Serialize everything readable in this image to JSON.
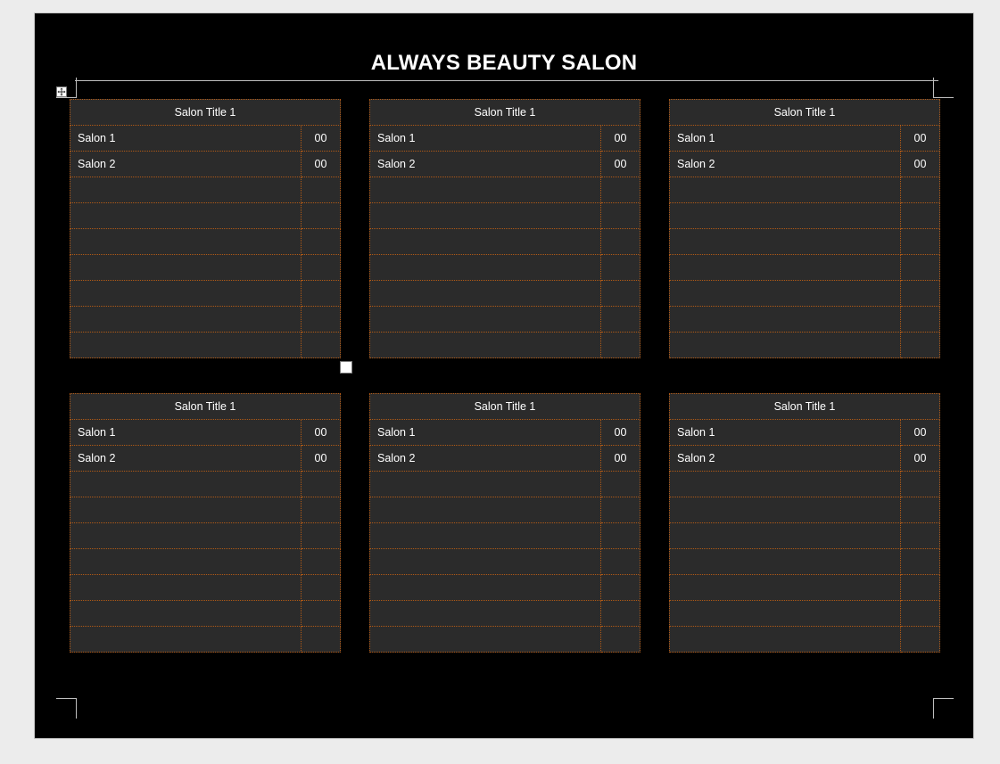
{
  "document": {
    "title": "ALWAYS BEAUTY SALON"
  },
  "tables": [
    {
      "header": "Salon Title 1",
      "rows": [
        {
          "name": "Salon 1",
          "price": "00"
        },
        {
          "name": "Salon 2",
          "price": "00"
        },
        {
          "name": "",
          "price": ""
        },
        {
          "name": "",
          "price": ""
        },
        {
          "name": "",
          "price": ""
        },
        {
          "name": "",
          "price": ""
        },
        {
          "name": "",
          "price": ""
        },
        {
          "name": "",
          "price": ""
        },
        {
          "name": "",
          "price": ""
        }
      ]
    },
    {
      "header": "Salon Title 1",
      "rows": [
        {
          "name": "Salon 1",
          "price": "00"
        },
        {
          "name": "Salon 2",
          "price": "00"
        },
        {
          "name": "",
          "price": ""
        },
        {
          "name": "",
          "price": ""
        },
        {
          "name": "",
          "price": ""
        },
        {
          "name": "",
          "price": ""
        },
        {
          "name": "",
          "price": ""
        },
        {
          "name": "",
          "price": ""
        },
        {
          "name": "",
          "price": ""
        }
      ]
    },
    {
      "header": "Salon Title 1",
      "rows": [
        {
          "name": "Salon 1",
          "price": "00"
        },
        {
          "name": "Salon 2",
          "price": "00"
        },
        {
          "name": "",
          "price": ""
        },
        {
          "name": "",
          "price": ""
        },
        {
          "name": "",
          "price": ""
        },
        {
          "name": "",
          "price": ""
        },
        {
          "name": "",
          "price": ""
        },
        {
          "name": "",
          "price": ""
        },
        {
          "name": "",
          "price": ""
        }
      ]
    },
    {
      "header": "Salon Title 1",
      "rows": [
        {
          "name": "Salon 1",
          "price": "00"
        },
        {
          "name": "Salon 2",
          "price": "00"
        },
        {
          "name": "",
          "price": ""
        },
        {
          "name": "",
          "price": ""
        },
        {
          "name": "",
          "price": ""
        },
        {
          "name": "",
          "price": ""
        },
        {
          "name": "",
          "price": ""
        },
        {
          "name": "",
          "price": ""
        },
        {
          "name": "",
          "price": ""
        }
      ]
    },
    {
      "header": "Salon Title 1",
      "rows": [
        {
          "name": "Salon 1",
          "price": "00"
        },
        {
          "name": "Salon 2",
          "price": "00"
        },
        {
          "name": "",
          "price": ""
        },
        {
          "name": "",
          "price": ""
        },
        {
          "name": "",
          "price": ""
        },
        {
          "name": "",
          "price": ""
        },
        {
          "name": "",
          "price": ""
        },
        {
          "name": "",
          "price": ""
        },
        {
          "name": "",
          "price": ""
        }
      ]
    },
    {
      "header": "Salon Title 1",
      "rows": [
        {
          "name": "Salon 1",
          "price": "00"
        },
        {
          "name": "Salon 2",
          "price": "00"
        },
        {
          "name": "",
          "price": ""
        },
        {
          "name": "",
          "price": ""
        },
        {
          "name": "",
          "price": ""
        },
        {
          "name": "",
          "price": ""
        },
        {
          "name": "",
          "price": ""
        },
        {
          "name": "",
          "price": ""
        },
        {
          "name": "",
          "price": ""
        }
      ]
    }
  ],
  "colors": {
    "page_background": "#000000",
    "table_background": "#2b2b2b",
    "cell_border": "#b15a16",
    "text": "#ffffff"
  },
  "icons": {
    "table_move_handle": "move-arrows-icon",
    "table_resize_handle": "resize-handle-icon"
  }
}
